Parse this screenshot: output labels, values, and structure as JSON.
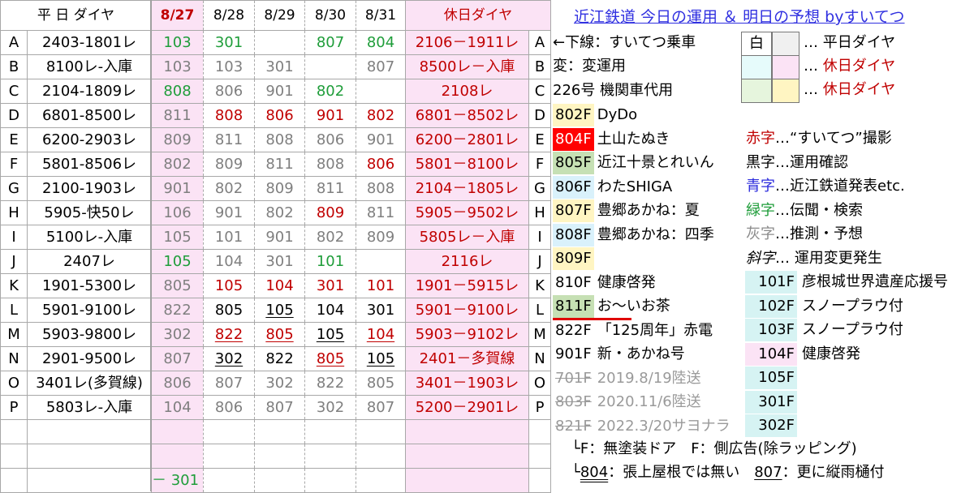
{
  "header": {
    "weekday_label": "平 日 ダイヤ",
    "dates": [
      "8/27",
      "8/28",
      "8/29",
      "8/30",
      "8/31"
    ],
    "holiday_label": "休日ダイヤ"
  },
  "rows": [
    {
      "letter": "A",
      "weekday": "2403-1801レ",
      "cells": [
        {
          "v": "103",
          "c": "green"
        },
        {
          "v": "301",
          "c": "green"
        },
        {
          "v": "",
          "c": ""
        },
        {
          "v": "807",
          "c": "green"
        },
        {
          "v": "804",
          "c": "green"
        }
      ],
      "holiday": "2106－1911レ"
    },
    {
      "letter": "B",
      "weekday": "8100レ-入庫",
      "cells": [
        {
          "v": "103",
          "c": "gray"
        },
        {
          "v": "103",
          "c": "gray"
        },
        {
          "v": "301",
          "c": "gray"
        },
        {
          "v": "",
          "c": ""
        },
        {
          "v": "807",
          "c": "gray"
        }
      ],
      "holiday": "8500レ－入庫"
    },
    {
      "letter": "C",
      "weekday": "2104-1809レ",
      "cells": [
        {
          "v": "808",
          "c": "green"
        },
        {
          "v": "806",
          "c": "gray"
        },
        {
          "v": "901",
          "c": "gray"
        },
        {
          "v": "802",
          "c": "green"
        },
        {
          "v": "",
          "c": ""
        }
      ],
      "holiday": "2108レ"
    },
    {
      "letter": "D",
      "weekday": "6801-8500レ",
      "cells": [
        {
          "v": "811",
          "c": "gray"
        },
        {
          "v": "808",
          "c": "red"
        },
        {
          "v": "806",
          "c": "red"
        },
        {
          "v": "901",
          "c": "red"
        },
        {
          "v": "802",
          "c": "red"
        }
      ],
      "holiday": "6801－8502レ"
    },
    {
      "letter": "E",
      "weekday": "6200-2903レ",
      "cells": [
        {
          "v": "809",
          "c": "gray"
        },
        {
          "v": "811",
          "c": "gray"
        },
        {
          "v": "808",
          "c": "gray"
        },
        {
          "v": "806",
          "c": "gray"
        },
        {
          "v": "901",
          "c": "gray"
        }
      ],
      "holiday": "6200－2801レ"
    },
    {
      "letter": "F",
      "weekday": "5801-8506レ",
      "cells": [
        {
          "v": "802",
          "c": "gray"
        },
        {
          "v": "809",
          "c": "gray"
        },
        {
          "v": "811",
          "c": "gray"
        },
        {
          "v": "808",
          "c": "gray"
        },
        {
          "v": "806",
          "c": "red"
        }
      ],
      "holiday": "5801－8100レ"
    },
    {
      "letter": "G",
      "weekday": "2100-1903レ",
      "cells": [
        {
          "v": "901",
          "c": "gray"
        },
        {
          "v": "802",
          "c": "gray"
        },
        {
          "v": "809",
          "c": "gray"
        },
        {
          "v": "811",
          "c": "gray"
        },
        {
          "v": "808",
          "c": "gray"
        }
      ],
      "holiday": "2104－1805レ"
    },
    {
      "letter": "H",
      "weekday": "5905-快50レ",
      "cells": [
        {
          "v": "106",
          "c": "gray"
        },
        {
          "v": "901",
          "c": "gray"
        },
        {
          "v": "802",
          "c": "gray"
        },
        {
          "v": "809",
          "c": "red"
        },
        {
          "v": "811",
          "c": "gray"
        }
      ],
      "holiday": "5905－9502レ"
    },
    {
      "letter": "I",
      "weekday": "5100レ-入庫",
      "cells": [
        {
          "v": "105",
          "c": "gray"
        },
        {
          "v": "101",
          "c": "gray"
        },
        {
          "v": "901",
          "c": "gray"
        },
        {
          "v": "802",
          "c": "gray"
        },
        {
          "v": "809",
          "c": "gray"
        }
      ],
      "holiday": "5805レ－入庫"
    },
    {
      "letter": "J",
      "weekday": "2407レ",
      "cells": [
        {
          "v": "105",
          "c": "green"
        },
        {
          "v": "104",
          "c": "gray"
        },
        {
          "v": "301",
          "c": "gray"
        },
        {
          "v": "101",
          "c": "green"
        },
        {
          "v": "",
          "c": ""
        }
      ],
      "holiday": "2116レ"
    },
    {
      "letter": "K",
      "weekday": "1901-5300レ",
      "cells": [
        {
          "v": "805",
          "c": "gray"
        },
        {
          "v": "105",
          "c": "red"
        },
        {
          "v": "104",
          "c": "red"
        },
        {
          "v": "301",
          "c": "red"
        },
        {
          "v": "101",
          "c": "red"
        }
      ],
      "holiday": "1901－5915レ"
    },
    {
      "letter": "L",
      "weekday": "5901-9100レ",
      "cells": [
        {
          "v": "822",
          "c": "gray"
        },
        {
          "v": "805",
          "c": "black"
        },
        {
          "v": "105",
          "c": "black u"
        },
        {
          "v": "104",
          "c": "black"
        },
        {
          "v": "301",
          "c": "black"
        }
      ],
      "holiday": "5901－9100レ"
    },
    {
      "letter": "M",
      "weekday": "5903-9800レ",
      "cells": [
        {
          "v": "302",
          "c": "gray"
        },
        {
          "v": "822",
          "c": "red u"
        },
        {
          "v": "805",
          "c": "red u"
        },
        {
          "v": "105",
          "c": "black u"
        },
        {
          "v": "104",
          "c": "red u"
        }
      ],
      "holiday": "5903－9102レ"
    },
    {
      "letter": "N",
      "weekday": "2901-9500レ",
      "cells": [
        {
          "v": "807",
          "c": "gray"
        },
        {
          "v": "302",
          "c": "black u"
        },
        {
          "v": "822",
          "c": "black"
        },
        {
          "v": "805",
          "c": "red u"
        },
        {
          "v": "105",
          "c": "black u"
        }
      ],
      "holiday": "2401－多賀線"
    },
    {
      "letter": "O",
      "weekday": "3401レ(多賀線)",
      "cells": [
        {
          "v": "806",
          "c": "gray"
        },
        {
          "v": "807",
          "c": "gray"
        },
        {
          "v": "302",
          "c": "gray"
        },
        {
          "v": "822",
          "c": "gray"
        },
        {
          "v": "805",
          "c": "gray"
        }
      ],
      "holiday": "3401－1903レ"
    },
    {
      "letter": "P",
      "weekday": "5803レ-入庫",
      "cells": [
        {
          "v": "104",
          "c": "gray"
        },
        {
          "v": "806",
          "c": "gray"
        },
        {
          "v": "807",
          "c": "gray"
        },
        {
          "v": "302",
          "c": "gray"
        },
        {
          "v": "807",
          "c": "gray"
        }
      ],
      "holiday": "5200－2901レ"
    }
  ],
  "extra_cell": "－ 301",
  "title": "近江鉄道 今日の運用 ＆ 明日の予想 byすいてつ",
  "legend_top": {
    "l1": "←下線：すいてつ乗車",
    "l2": "変：変運用",
    "l3": "226号 機関車代用",
    "white_box": "白",
    "r1": "… 平日ダイヤ",
    "r2a": "… ",
    "r2b": "休日ダイヤ",
    "r3a": "… ",
    "r3b": "休日ダイヤ"
  },
  "cars": [
    {
      "no": "802F",
      "cls": "y",
      "name": "DyDo"
    },
    {
      "no": "804F",
      "cls": "dr",
      "name": "土山たぬき"
    },
    {
      "no": "805F",
      "cls": "gr",
      "name": "近江十景とれいん"
    },
    {
      "no": "806F",
      "cls": "bl",
      "name": "わたSHIGA"
    },
    {
      "no": "807F",
      "cls": "y",
      "name": "豊郷あかね：夏"
    },
    {
      "no": "808F",
      "cls": "bl",
      "name": "豊郷あかね：四季"
    },
    {
      "no": "809F",
      "cls": "y",
      "name": ""
    },
    {
      "no": "810F",
      "cls": "",
      "name": "健康啓発"
    },
    {
      "no": "811F",
      "cls": "gr",
      "name": "お～いお茶"
    },
    {
      "no": "822F",
      "cls": "",
      "name": "「125周年」赤電"
    },
    {
      "no": "901F",
      "cls": "",
      "name": "新・あかね号"
    },
    {
      "no": "701F",
      "cls": "",
      "name": "2019.8/19陸送"
    },
    {
      "no": "803F",
      "cls": "",
      "name": "2020.11/6陸送"
    },
    {
      "no": "821F",
      "cls": "",
      "name": "2022.3/20サヨナラ"
    }
  ],
  "color_legend": [
    {
      "k": "赤字",
      "c": "hol",
      "t": "…“すいてつ”撮影"
    },
    {
      "k": "黒字",
      "c": "black",
      "t": "…運用確認"
    },
    {
      "k": "青字",
      "c": "blue",
      "t": "…近江鉄道発表etc."
    },
    {
      "k": "緑字",
      "c": "lgreen",
      "t": "…伝聞・検索"
    },
    {
      "k": "灰字",
      "c": "lgray",
      "t": "…推測・予想"
    },
    {
      "k": "斜字",
      "c": "ital",
      "t": "… 運用変更発生"
    }
  ],
  "cars100": [
    {
      "no": "101F",
      "cls": "cy",
      "name": "彦根城世界遺産応援号"
    },
    {
      "no": "102F",
      "cls": "cy",
      "name": "スノープラウ付"
    },
    {
      "no": "103F",
      "cls": "cy",
      "name": "スノープラウ付"
    },
    {
      "no": "104F",
      "cls": "pk",
      "name": "健康啓発"
    },
    {
      "no": "105F",
      "cls": "cy",
      "name": ""
    },
    {
      "no": "301F",
      "cls": "cy",
      "name": ""
    },
    {
      "no": "302F",
      "cls": "cy",
      "name": ""
    }
  ],
  "notes": {
    "n1": "└F：無塗装ドア　F：側広告(除ラッピング)",
    "n2a": "└",
    "n2b": "804",
    "n2c": "：張上屋根では無い　",
    "n2d": "807",
    "n2e": "：更に縦雨樋付"
  },
  "colors": {
    "holiday_bg": "#fbe3f5",
    "red": "#c00000",
    "green": "#1f9d3a",
    "gray": "#7f7f7f",
    "title": "#3030e0"
  }
}
